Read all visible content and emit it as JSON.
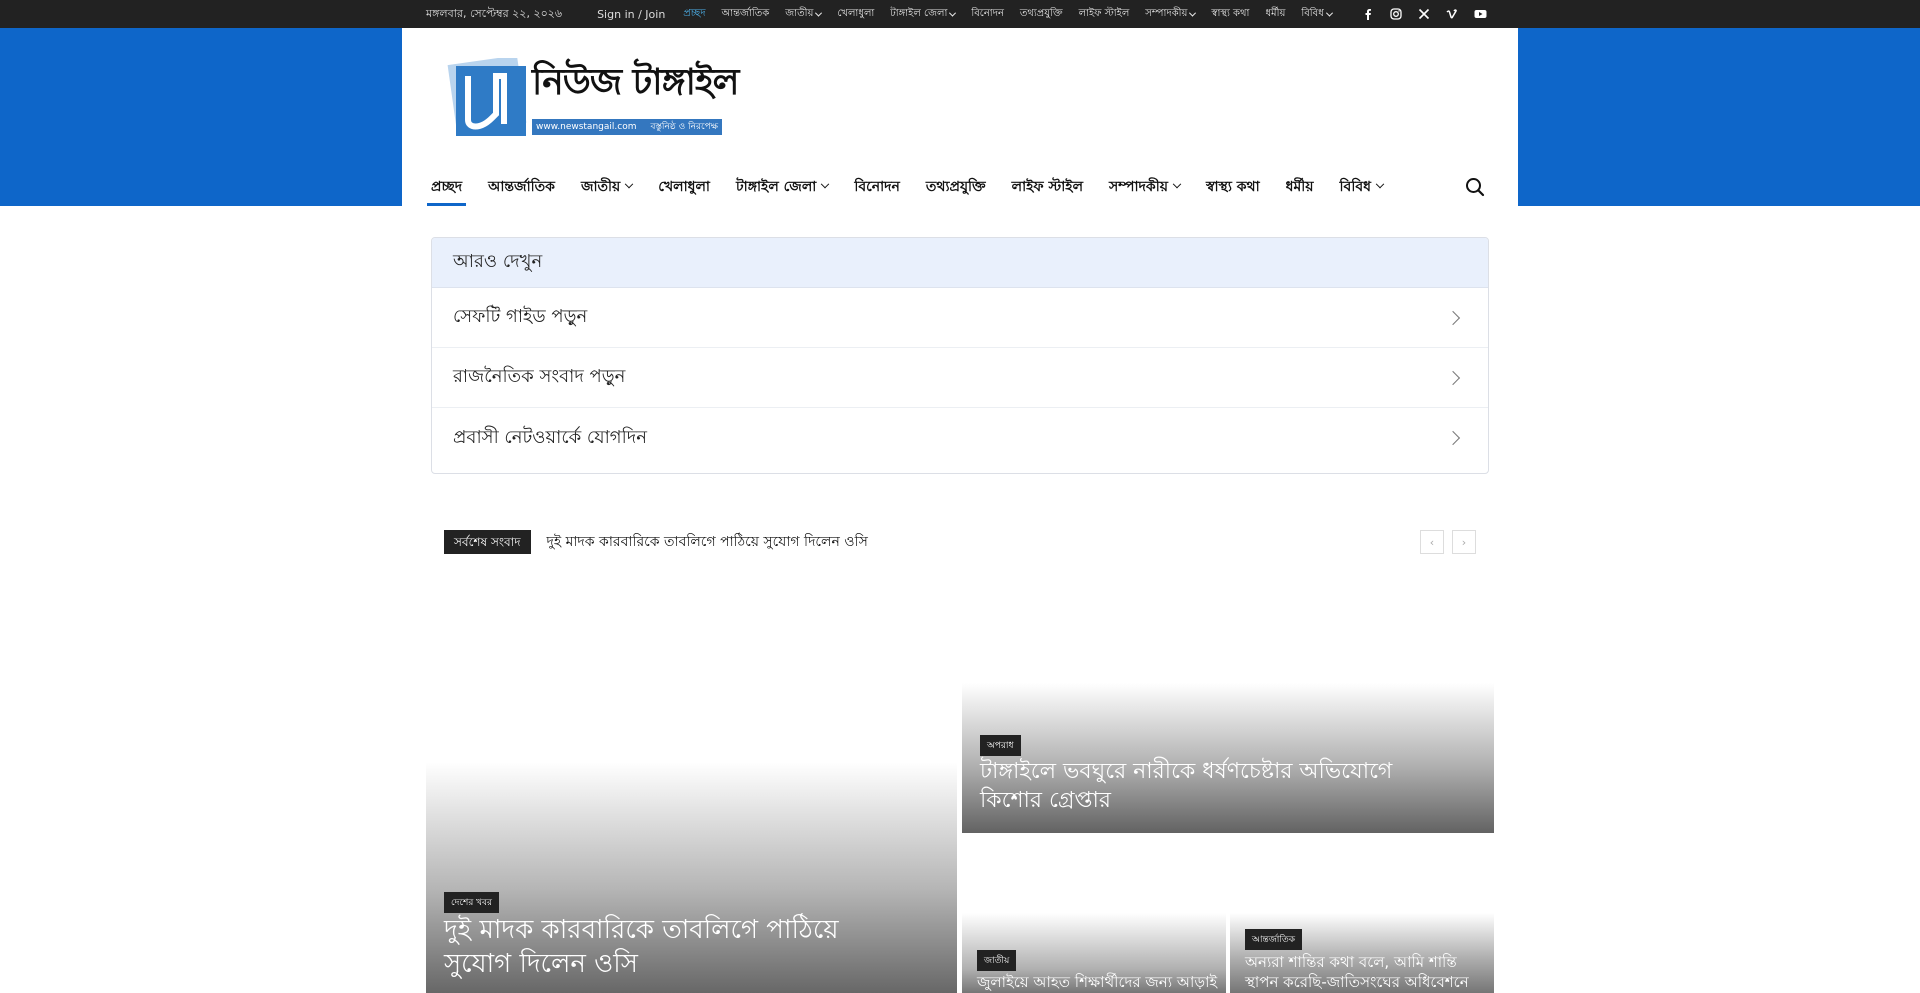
{
  "topbar": {
    "date": "মঙ্গলবার, সেপ্টেম্বর ২২, ২০২৬",
    "signin": "Sign in / Join",
    "menu": [
      {
        "label": "প্রচ্ছদ"
      },
      {
        "label": "আন্তর্জাতিক"
      },
      {
        "label": "জাতীয়"
      },
      {
        "label": "খেলাধুলা"
      },
      {
        "label": "টাঙ্গাইল জেলা"
      },
      {
        "label": "বিনোদন"
      },
      {
        "label": "তথ্যপ্রযুক্তি"
      },
      {
        "label": "লাইফ স্টাইল"
      },
      {
        "label": "সম্পাদকীয়"
      },
      {
        "label": "স্বাস্থ্য কথা"
      },
      {
        "label": "ধর্মীয়"
      },
      {
        "label": "বিবিধ"
      }
    ],
    "social_icons": [
      "facebook-icon",
      "instagram-icon",
      "x-icon",
      "vimeo-icon",
      "youtube-icon"
    ]
  },
  "logo": {
    "name": "নিউজ টাঙ্গাইল",
    "url": "www.newstangail.com",
    "tagline": "বস্তুনিষ্ঠ ও নিরপেক্ষ"
  },
  "nav": {
    "items": [
      {
        "label": "প্রচ্ছদ"
      },
      {
        "label": "আন্তর্জাতিক"
      },
      {
        "label": "জাতীয়"
      },
      {
        "label": "খেলাধুলা"
      },
      {
        "label": "টাঙ্গাইল জেলা"
      },
      {
        "label": "বিনোদন"
      },
      {
        "label": "তথ্যপ্রযুক্তি"
      },
      {
        "label": "লাইফ স্টাইল"
      },
      {
        "label": "সম্পাদকীয়"
      },
      {
        "label": "স্বাস্থ্য কথা"
      },
      {
        "label": "ধর্মীয়"
      },
      {
        "label": "বিবিধ"
      }
    ]
  },
  "also": {
    "heading": "আরও দেখুন",
    "items": [
      {
        "label": "সেফটি গাইড পড়ুন"
      },
      {
        "label": "রাজনৈতিক সংবাদ পড়ুন"
      },
      {
        "label": "প্রবাসী নেটওয়ার্কে যোগদিন"
      }
    ]
  },
  "ticker": {
    "label": "সর্বশেষ সংবাদ",
    "headline": "দুই মাদক কারবারিকে তাবলিগে পাঠিয়ে সুযোগ দিলেন ওসি",
    "prev": "‹",
    "next": "›"
  },
  "cards": [
    {
      "category": "দেশের খবর",
      "title_line1": "দুই মাদক কারবারিকে তাবলিগে পাঠিয়ে",
      "title_line2": "সুযোগ দিলেন ওসি"
    },
    {
      "category": "অপরাধ",
      "title_line1": "টাঙ্গাইলে ভবঘুরে নারীকে ধর্ষণচেষ্টার অভিযোগে",
      "title_line2": "কিশোর গ্রেপ্তার"
    },
    {
      "category": "জাতীয়",
      "title_line1": "জুলাইয়ে আহত শিক্ষার্থীদের জন্য আড়াই"
    },
    {
      "category": "আন্তর্জাতিক",
      "title_line1": "অন্যরা শান্তির কথা বলে, আমি শান্তি",
      "title_line2": "স্থাপন করেছি-জাতিসংঘের অধিবেশনে"
    }
  ],
  "colors": {
    "brand_blue": "#0e66c9",
    "topbar_bg": "#222222",
    "active_link": "#4db2ec"
  }
}
